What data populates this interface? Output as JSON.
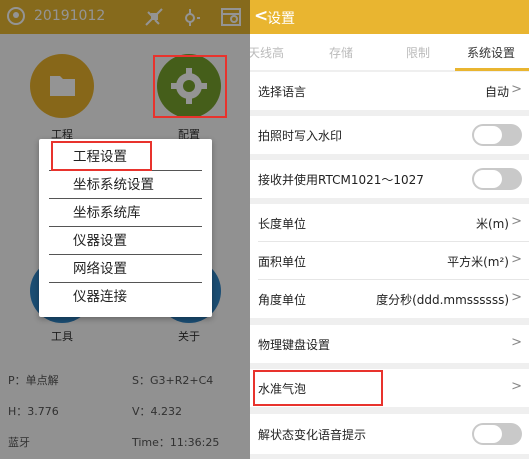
{
  "left": {
    "date": "20191012",
    "tiles": [
      {
        "label": "工程",
        "color": "#e8b22c"
      },
      {
        "label": "配置",
        "color": "#78a32d"
      },
      {
        "label": "工具",
        "color": "#2f86c7"
      },
      {
        "label": "关于",
        "color": "#2f86c7"
      }
    ],
    "menu": {
      "items": [
        "工程设置",
        "坐标系统设置",
        "坐标系统库",
        "仪器设置",
        "网络设置",
        "仪器连接"
      ]
    },
    "status": {
      "p": "P：单点解",
      "s": "S：G3+R2+C4",
      "h": "H：3.776",
      "v": "V：4.232",
      "bt": "蓝牙",
      "time": "Time：11:36:25"
    }
  },
  "right": {
    "header": {
      "back": "<",
      "title": "设置"
    },
    "tabs": [
      "天线高",
      "存储",
      "限制",
      "系统设置"
    ],
    "rows": [
      {
        "label": "选择语言",
        "value": "自动"
      },
      {
        "label": "拍照时写入水印"
      },
      {
        "label": "接收并使用RTCM1021～1027"
      },
      {
        "label": "长度单位",
        "value": "米(m)"
      },
      {
        "label": "面积单位",
        "value": "平方米(m²)"
      },
      {
        "label": "角度单位",
        "value": "度分秒(ddd.mmssssss)"
      },
      {
        "label": "物理键盘设置"
      },
      {
        "label": "水准气泡"
      },
      {
        "label": "解状态变化语音提示"
      }
    ],
    "chevron": ">"
  },
  "colors": {
    "accent": "#e9b530",
    "highlight": "#e8332d"
  }
}
